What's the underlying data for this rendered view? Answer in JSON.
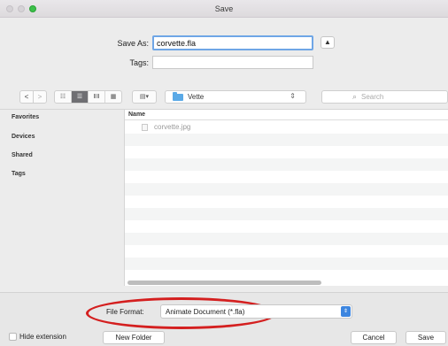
{
  "window": {
    "title": "Save"
  },
  "save_as": {
    "label": "Save As:",
    "value": "corvette.fla"
  },
  "tags": {
    "label": "Tags:",
    "value": ""
  },
  "toolbar": {
    "back": "<",
    "forward": ">",
    "views": [
      "☷",
      "☰",
      "ⅡⅡ",
      "▦"
    ],
    "arrange": "▤▾",
    "location": "Vette",
    "location_arrows": "⇕",
    "search_icon": "⌕",
    "search_placeholder": "Search"
  },
  "sidebar": {
    "items": [
      {
        "label": "Favorites"
      },
      {
        "label": "Devices"
      },
      {
        "label": "Shared"
      },
      {
        "label": "Tags"
      }
    ]
  },
  "file_list": {
    "column_name": "Name",
    "files": [
      {
        "name": "corvette.jpg"
      }
    ]
  },
  "bottom": {
    "file_format_label": "File Format:",
    "file_format_value": "Animate Document (*.fla)",
    "stepper": "⇕",
    "hide_extension_label": "Hide extension",
    "new_folder_label": "New Folder",
    "cancel_label": "Cancel",
    "save_label": "Save"
  },
  "colors": {
    "accent": "#3d86e0",
    "highlight_ring": "#d41f1f",
    "folder": "#5aa9e6"
  }
}
